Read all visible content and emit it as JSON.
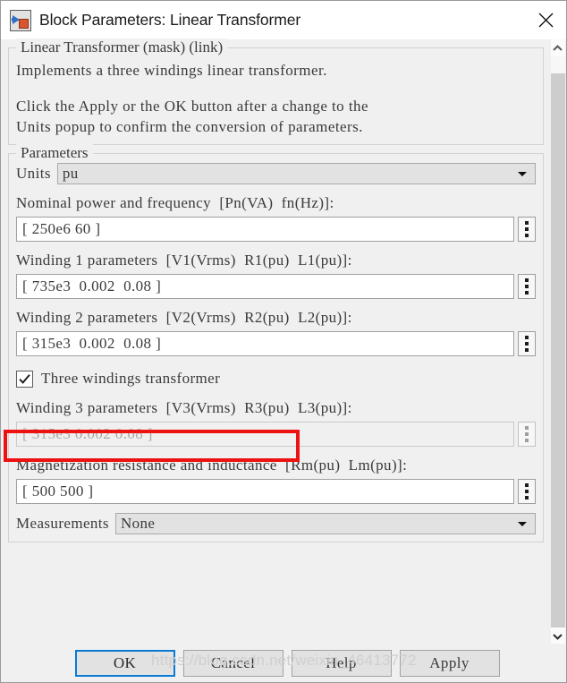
{
  "window": {
    "title": "Block Parameters: Linear Transformer",
    "icon": "simulink-block-icon",
    "close_label": "×"
  },
  "description": {
    "legend": "Linear Transformer (mask) (link)",
    "line1": "Implements a three windings linear transformer.",
    "line2": "Click the Apply or the OK button after a change to the",
    "line3": "Units popup to confirm the conversion of parameters."
  },
  "parameters": {
    "legend": "Parameters",
    "units": {
      "label": "Units",
      "value": "pu"
    },
    "nominal": {
      "label": "Nominal power and frequency  [Pn(VA)  fn(Hz)]:",
      "value": "[ 250e6 60 ]"
    },
    "winding1": {
      "label": "Winding 1 parameters  [V1(Vrms)  R1(pu)  L1(pu)]:",
      "value": "[ 735e3  0.002  0.08 ]"
    },
    "winding2": {
      "label": "Winding 2 parameters  [V2(Vrms)  R2(pu)  L2(pu)]:",
      "value": "[ 315e3  0.002  0.08 ]"
    },
    "three_windings": {
      "label": "Three windings transformer",
      "checked": "true"
    },
    "winding3": {
      "label": "Winding 3 parameters  [V3(Vrms)  R3(pu)  L3(pu)]:",
      "value": "[ 315e3 0.002 0.08 ]"
    },
    "magnetization": {
      "label": "Magnetization resistance and inductance  [Rm(pu)  Lm(pu)]:",
      "value": "[ 500 500 ]"
    },
    "measurements": {
      "label": "Measurements",
      "value": "None"
    }
  },
  "buttons": {
    "ok": "OK",
    "cancel": "Cancel",
    "help": "Help",
    "apply": "Apply"
  },
  "overlay": {
    "watermark": "https://blog.csdn.net/weixin_46413772",
    "highlight_color": "#ee1111"
  }
}
